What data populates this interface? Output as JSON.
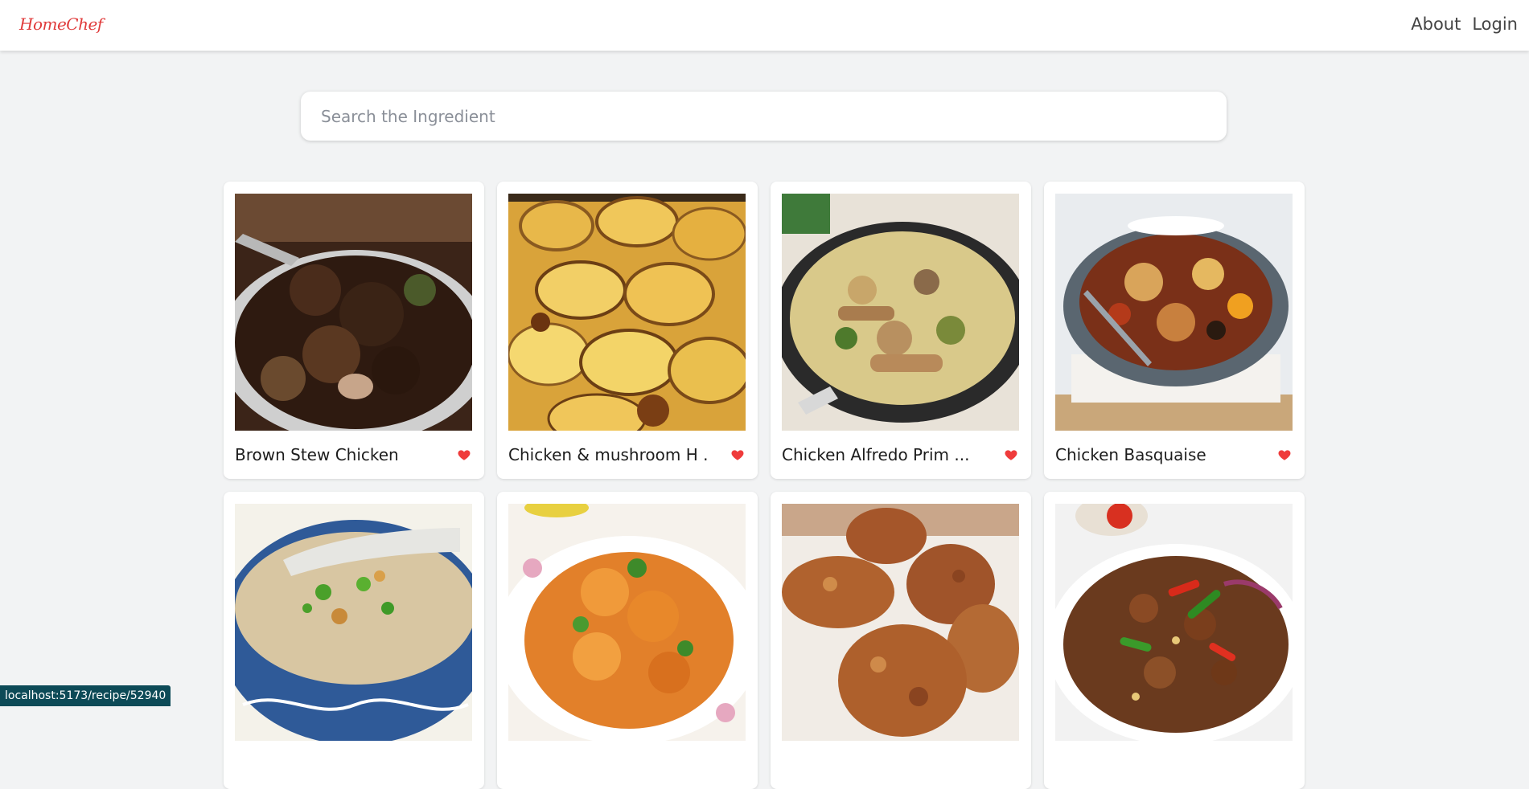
{
  "navbar": {
    "logo_text": "HomeChef",
    "links": [
      "About",
      "Login"
    ]
  },
  "search": {
    "placeholder": "Search the Ingredient",
    "value": ""
  },
  "recipes": [
    {
      "title": "Brown Stew Chicken",
      "image": "brown-stew-chicken-image",
      "favorite": true
    },
    {
      "title": "Chicken & mushroom H ...",
      "image": "chicken-mushroom-hotpot-image",
      "favorite": true
    },
    {
      "title": "Chicken Alfredo Prim ...",
      "image": "chicken-alfredo-primavera-image",
      "favorite": true
    },
    {
      "title": "Chicken Basquaise",
      "image": "chicken-basquaise-image",
      "favorite": true
    },
    {
      "title": "",
      "image": "congee-bowl-image",
      "favorite": false
    },
    {
      "title": "",
      "image": "chicken-curry-image",
      "favorite": false
    },
    {
      "title": "",
      "image": "fried-chicken-image",
      "favorite": false
    },
    {
      "title": "",
      "image": "chicken-stir-fry-image",
      "favorite": false
    }
  ],
  "status_bar": {
    "url": "localhost:5173/recipe/52940"
  },
  "colors": {
    "accent": "#e03a3a",
    "background": "#f2f3f4",
    "heart": "#ef3b3b",
    "status_bar": "#0d4a57"
  }
}
